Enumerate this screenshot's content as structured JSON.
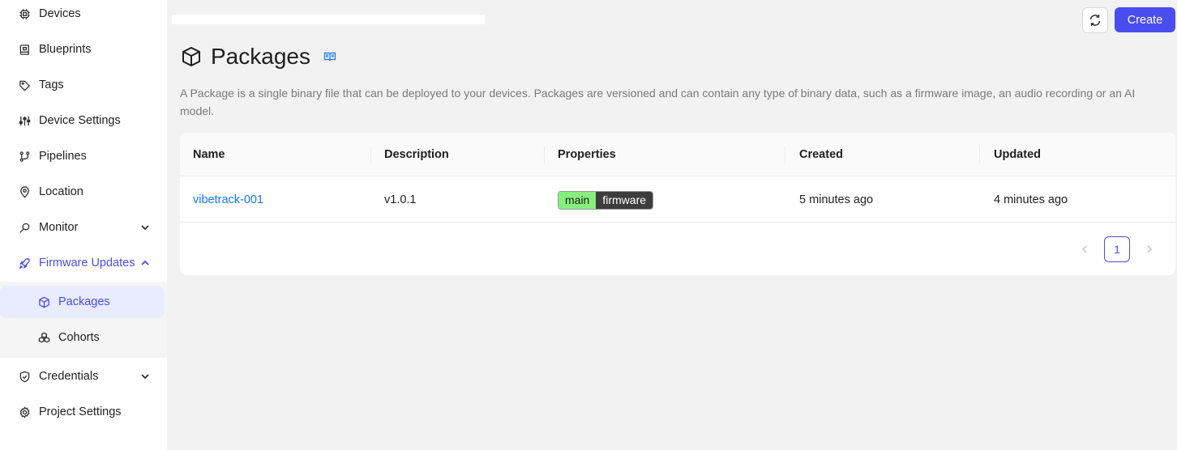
{
  "sidebar": {
    "items": [
      {
        "label": "Devices",
        "icon": "chip-icon"
      },
      {
        "label": "Blueprints",
        "icon": "blueprint-icon"
      },
      {
        "label": "Tags",
        "icon": "tag-icon"
      },
      {
        "label": "Device Settings",
        "icon": "sliders-icon"
      },
      {
        "label": "Pipelines",
        "icon": "pipeline-icon"
      },
      {
        "label": "Location",
        "icon": "location-pin-icon"
      },
      {
        "label": "Monitor",
        "icon": "monitor-icon"
      },
      {
        "label": "Firmware Updates",
        "icon": "rocket-icon"
      },
      {
        "label": "Credentials",
        "icon": "shield-icon"
      },
      {
        "label": "Project Settings",
        "icon": "gear-icon"
      }
    ],
    "subitems": [
      {
        "label": "Packages",
        "icon": "package-icon"
      },
      {
        "label": "Cohorts",
        "icon": "cohorts-icon"
      }
    ]
  },
  "header": {
    "create_label": "Create"
  },
  "page": {
    "title": "Packages",
    "description": "A Package is a single binary file that can be deployed to your devices. Packages are versioned and can contain any type of binary data, such as a firmware image, an audio recording or an AI model."
  },
  "table": {
    "columns": [
      "Name",
      "Description",
      "Properties",
      "Created",
      "Updated"
    ],
    "rows": [
      {
        "name": "vibetrack-001",
        "description": "v1.0.1",
        "property_key": "main",
        "property_value": "firmware",
        "created": "5 minutes ago",
        "updated": "4 minutes ago"
      }
    ]
  },
  "pagination": {
    "current_page": "1",
    "prev": "‹",
    "next": "›"
  },
  "colors": {
    "accent": "#4a4df0",
    "link": "#1677ff",
    "tag_key_bg": "#86ef7e",
    "tag_value_bg": "#3d3d3d"
  }
}
